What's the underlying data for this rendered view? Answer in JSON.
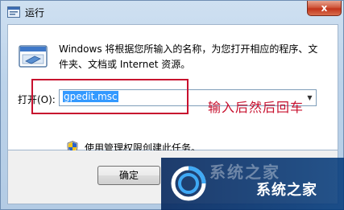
{
  "window": {
    "title": "运行",
    "close_label": "x"
  },
  "dialog": {
    "description": "Windows 将根据您所输入的名称，为您打开相应的程序、文件夹、文档或 Internet 资源。",
    "open_label": "打开(O):",
    "command_value": "gpedit.msc",
    "admin_note": "使用管理权限创建此任务。",
    "ok_label": "确定"
  },
  "annotation": {
    "text": "输入后然后回车",
    "color": "#c8102e"
  },
  "watermark": {
    "text": "系统之家"
  },
  "icons": {
    "title": "run-window-icon",
    "dialog": "run-program-icon",
    "admin": "uac-shield-icon",
    "dropdown": "dropdown-arrow-icon",
    "watermark": "xitongzhijia-logo-icon"
  }
}
